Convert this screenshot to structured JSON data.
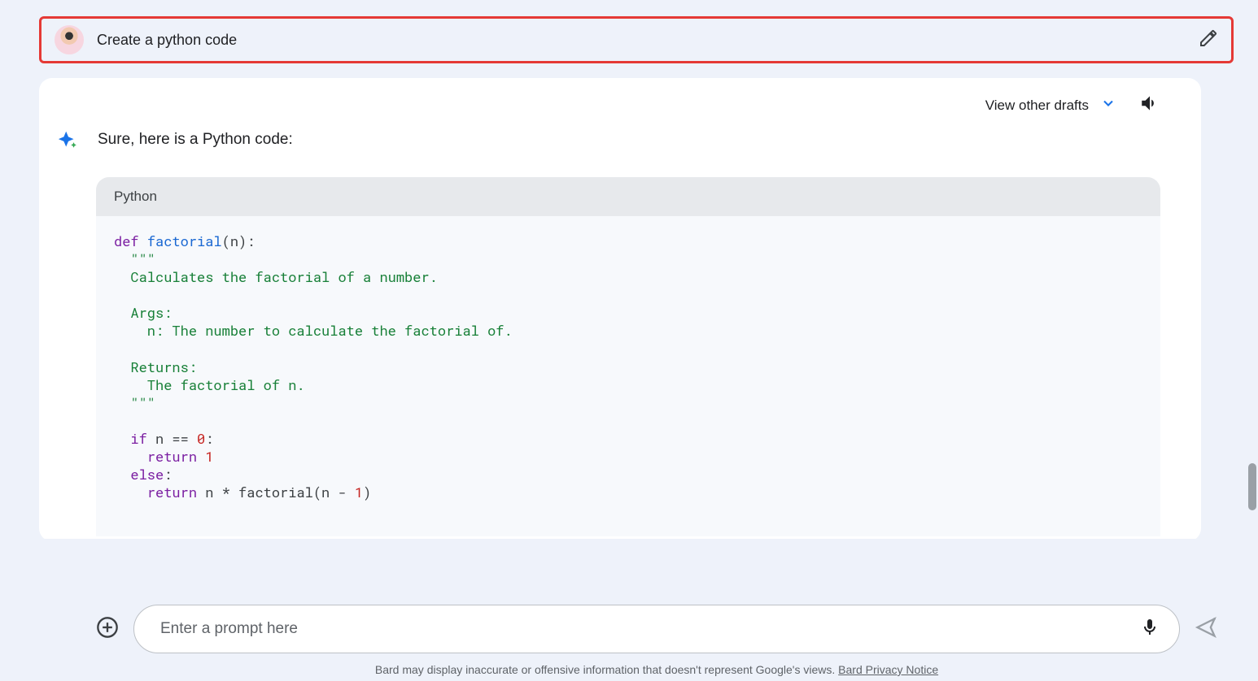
{
  "user_prompt": "Create a python code",
  "response": {
    "drafts_label": "View other drafts",
    "intro": "Sure, here is a Python code:",
    "code_lang": "Python",
    "code": {
      "l1a": "def",
      "l1b": " ",
      "l1c": "factorial",
      "l1d": "(n):",
      "l2": "  \"\"\"",
      "l3": "  Calculates the factorial of a number.",
      "l4": "",
      "l5": "  Args:",
      "l6": "    n: The number to calculate the factorial of.",
      "l7": "",
      "l8": "  Returns:",
      "l9": "    The factorial of n.",
      "l10": "  \"\"\"",
      "l11": "",
      "l12a": "  ",
      "l12b": "if",
      "l12c": " n == ",
      "l12d": "0",
      "l12e": ":",
      "l13a": "    ",
      "l13b": "return",
      "l13c": " ",
      "l13d": "1",
      "l14a": "  ",
      "l14b": "else",
      "l14c": ":",
      "l15a": "    ",
      "l15b": "return",
      "l15c": " n * factorial(n - ",
      "l15d": "1",
      "l15e": ")"
    }
  },
  "input": {
    "placeholder": "Enter a prompt here"
  },
  "disclaimer": {
    "text": "Bard may display inaccurate or offensive information that doesn't represent Google's views. ",
    "link": "Bard Privacy Notice"
  }
}
